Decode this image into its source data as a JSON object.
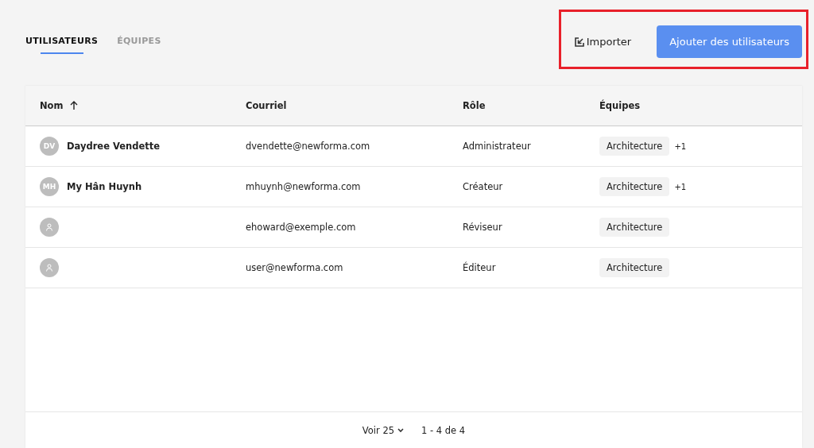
{
  "tabs": [
    {
      "label": "UTILISATEURS",
      "selected": true
    },
    {
      "label": "ÉQUIPES",
      "selected": false
    }
  ],
  "actions": {
    "import": "Importer",
    "add": "Ajouter des utilisateurs"
  },
  "table": {
    "columns": [
      {
        "label": "Nom",
        "sorted": true
      },
      {
        "label": "Courriel",
        "sorted": false
      },
      {
        "label": "Rôle",
        "sorted": false
      },
      {
        "label": "Équipes",
        "sorted": false
      }
    ],
    "rows": [
      {
        "initials": "DV",
        "name": "Daydree Vendette",
        "email": "dvendette@newforma.com",
        "role": "Administrateur",
        "team": "Architecture",
        "more": "+1"
      },
      {
        "initials": "MH",
        "name": "My Hân Huynh",
        "email": "mhuynh@newforma.com",
        "role": "Créateur",
        "team": "Architecture",
        "more": "+1"
      },
      {
        "email": "ehoward@exemple.com",
        "role": "Réviseur",
        "team": "Architecture"
      },
      {
        "email": "user@newforma.com",
        "role": "Éditeur",
        "team": "Architecture"
      }
    ]
  },
  "pagination": {
    "page_size": "Voir 25",
    "range": "1 - 4 de 4"
  }
}
